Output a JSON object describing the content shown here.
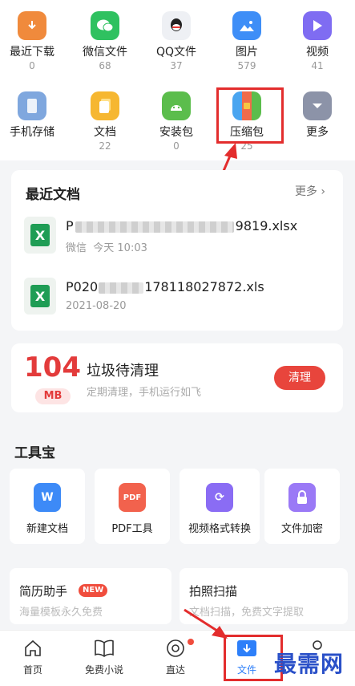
{
  "categories": [
    {
      "label": "最近下载",
      "count": "0",
      "icon": "download-icon",
      "color": "#f08a3c"
    },
    {
      "label": "微信文件",
      "count": "68",
      "icon": "wechat-icon",
      "color": "#2fc160"
    },
    {
      "label": "QQ文件",
      "count": "37",
      "icon": "qq-icon",
      "color": "#eef0f4"
    },
    {
      "label": "图片",
      "count": "579",
      "icon": "image-icon",
      "color": "#3e8ef7"
    },
    {
      "label": "视频",
      "count": "41",
      "icon": "video-icon",
      "color": "#7f6cf2"
    },
    {
      "label": "手机存储",
      "count": "",
      "icon": "phone-storage-icon",
      "color": "#7fa7de"
    },
    {
      "label": "文档",
      "count": "22",
      "icon": "document-icon",
      "color": "#f6b731"
    },
    {
      "label": "安装包",
      "count": "0",
      "icon": "android-icon",
      "color": "#5bbd4c"
    },
    {
      "label": "压缩包",
      "count": "25",
      "icon": "archive-icon",
      "color": "#4aa5f0"
    },
    {
      "label": "更多",
      "count": "",
      "icon": "chevron-down-icon",
      "color": "#8c93a8"
    }
  ],
  "recent": {
    "title": "最近文档",
    "more": "更多",
    "docs": [
      {
        "name_prefix": "P",
        "name_visible": "9819.xlsx",
        "meta_source": "微信",
        "meta_time": "今天 10:03"
      },
      {
        "name_prefix": "P020",
        "name_visible": "178118027872.xls",
        "meta_time": "2021-08-20"
      }
    ]
  },
  "cleanup": {
    "number": "104",
    "unit": "MB",
    "title": "垃圾待清理",
    "subtitle": "定期清理，手机运行如飞",
    "button": "清理"
  },
  "toolbox": {
    "title": "工具宝",
    "tools": [
      {
        "label": "新建文档",
        "icon": "word-icon",
        "glyph": "W",
        "color": "#3d8af7"
      },
      {
        "label": "PDF工具",
        "icon": "pdf-icon",
        "glyph": "PDF",
        "color": "#f2624d"
      },
      {
        "label": "视频格式转换",
        "icon": "video-convert-icon",
        "glyph": "⟳",
        "color": "#8a6cf4"
      },
      {
        "label": "文件加密",
        "icon": "lock-icon",
        "glyph": "🔒",
        "color": "#9a79f6"
      }
    ]
  },
  "promos": [
    {
      "title": "简历助手",
      "badge": "NEW",
      "subtitle": "海量模板永久免费"
    },
    {
      "title": "拍照扫描",
      "subtitle": "文档扫描，免费文字提取"
    }
  ],
  "nav": [
    {
      "label": "首页",
      "icon": "home-icon"
    },
    {
      "label": "免费小说",
      "icon": "book-icon"
    },
    {
      "label": "直达",
      "icon": "direct-icon"
    },
    {
      "label": "文件",
      "icon": "file-icon"
    },
    {
      "label": "",
      "icon": "profile-icon"
    }
  ],
  "watermark": "最需网",
  "colors": {
    "accent": "#2d7ff9",
    "highlight": "#e32d2d",
    "danger": "#e33b3b"
  }
}
